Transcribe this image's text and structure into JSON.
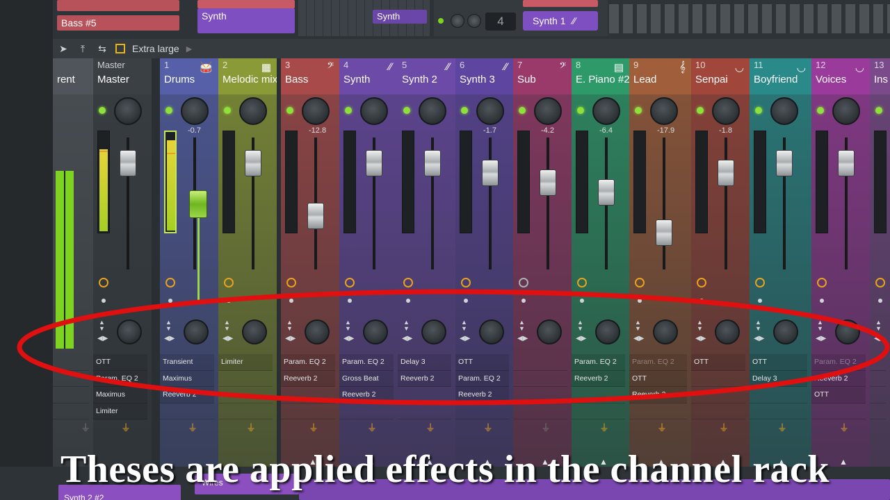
{
  "top": {
    "patterns": {
      "bass": "Bass #5",
      "synth": "Synth",
      "synth_mini": "Synth"
    },
    "channel_number": "4",
    "channel_name": "Synth 1"
  },
  "toolbar": {
    "size_label": "Extra large"
  },
  "tracks": [
    {
      "num": "",
      "name": "rent",
      "color": "#4f555a",
      "vol": "",
      "fx": [
        "",
        "",
        "",
        ""
      ],
      "route": "off"
    },
    {
      "num": "Master",
      "name": "Master",
      "color": "#3a4044",
      "vol": "",
      "fx": [
        "OTT",
        "Param. EQ 2",
        "Maximus",
        "Limiter"
      ],
      "route": "on"
    },
    {
      "num": "1",
      "name": "Drums",
      "color": "#5560a8",
      "vol": "-0.7",
      "fx": [
        "Transient",
        "Maximus",
        "Reeverb 2",
        ""
      ],
      "route": "on"
    },
    {
      "num": "2",
      "name": "Melodic mix",
      "color": "#8a9a36",
      "vol": "",
      "fx": [
        "Limiter",
        "",
        "",
        ""
      ],
      "route": "on"
    },
    {
      "num": "3",
      "name": "Bass",
      "color": "#a84a4a",
      "vol": "-12.8",
      "fx": [
        "Param. EQ 2",
        "Reeverb 2",
        "",
        ""
      ],
      "route": "on"
    },
    {
      "num": "4",
      "name": "Synth",
      "color": "#6b4aa8",
      "vol": "",
      "fx": [
        "Param. EQ 2",
        "Gross Beat",
        "Reeverb 2",
        ""
      ],
      "route": "on"
    },
    {
      "num": "5",
      "name": "Synth 2",
      "color": "#6b4aa8",
      "vol": "",
      "fx": [
        "Delay 3",
        "Reeverb 2",
        "",
        ""
      ],
      "route": "on"
    },
    {
      "num": "6",
      "name": "Synth 3",
      "color": "#5e46a0",
      "vol": "-1.7",
      "fx": [
        "OTT",
        "Param. EQ 2",
        "Reeverb 2",
        ""
      ],
      "route": "on"
    },
    {
      "num": "7",
      "name": "Sub",
      "color": "#9a3a6a",
      "vol": "-4.2",
      "fx": [
        "",
        "",
        "",
        ""
      ],
      "route": "off"
    },
    {
      "num": "8",
      "name": "E. Piano #2",
      "color": "#2e9a6a",
      "vol": "-6.4",
      "fx": [
        "Param. EQ 2",
        "Reeverb 2",
        "",
        ""
      ],
      "route": "on"
    },
    {
      "num": "9",
      "name": "Lead",
      "color": "#a05e3a",
      "vol": "-17.9",
      "fx": [
        "Param. EQ 2",
        "OTT",
        "Reeverb 2",
        ""
      ],
      "route": "on"
    },
    {
      "num": "10",
      "name": "Senpai",
      "color": "#a0463a",
      "vol": "-1.8",
      "fx": [
        "OTT",
        "",
        "",
        ""
      ],
      "route": "on"
    },
    {
      "num": "11",
      "name": "Boyfriend",
      "color": "#2a8a8a",
      "vol": "",
      "fx": [
        "OTT",
        "Delay 3",
        "",
        ""
      ],
      "route": "on"
    },
    {
      "num": "12",
      "name": "Voices",
      "color": "#9a3a9a",
      "vol": "",
      "fx": [
        "Param. EQ 2",
        "Reeverb 2",
        "OTT",
        ""
      ],
      "route": "on"
    },
    {
      "num": "13",
      "name": "Ins",
      "color": "#7a4a8a",
      "vol": "",
      "fx": [
        "",
        "",
        "",
        ""
      ],
      "route": "on"
    }
  ],
  "caption": "Theses are applied effects in the channel rack",
  "bottom": {
    "label_1": "Synth 2 #2",
    "label_2": "Wires"
  },
  "colors": {
    "highlight_ellipse": "#e01010",
    "led_green": "#8fe03a",
    "accent_orange": "#e8a21d"
  }
}
